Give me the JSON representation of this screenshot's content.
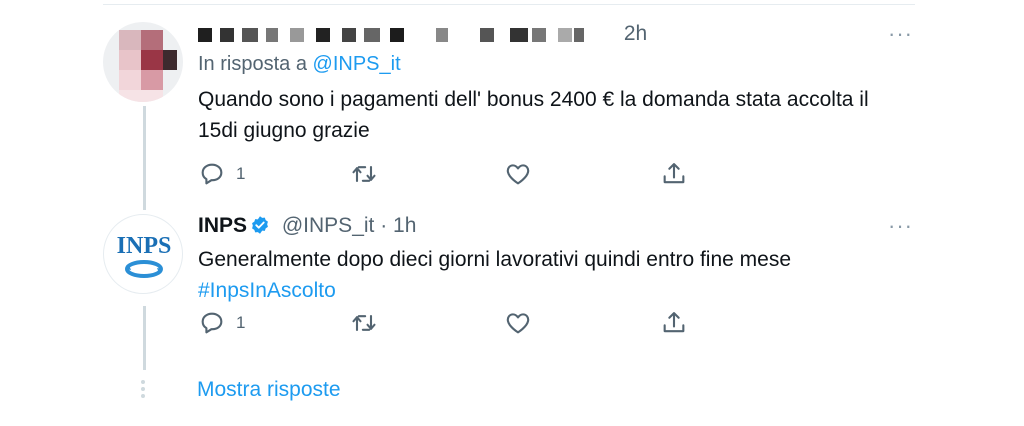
{
  "tweet1": {
    "time": "2h",
    "reply_prefix": "In risposta a",
    "reply_handle": "@INPS_it",
    "text": "Quando sono i pagamenti dell' bonus 2400 € la domanda stata accolta il 15di giugno grazie",
    "reply_count": "1",
    "icons": [
      "reply-icon",
      "retweet-icon",
      "like-icon",
      "share-icon"
    ]
  },
  "tweet2": {
    "name": "INPS",
    "handle": "@INPS_it · 1h",
    "text": "Generalmente dopo dieci giorni lavorativi quindi entro fine mese",
    "hashtag": "#InpsInAscolto",
    "reply_count": "1",
    "avatar_text": "INPS"
  },
  "more_menu": "···",
  "show_replies": "Mostra risposte",
  "colors": {
    "accent": "#1d9bf0",
    "secondary": "#536471",
    "inps_blue": "#1a6fb5"
  }
}
